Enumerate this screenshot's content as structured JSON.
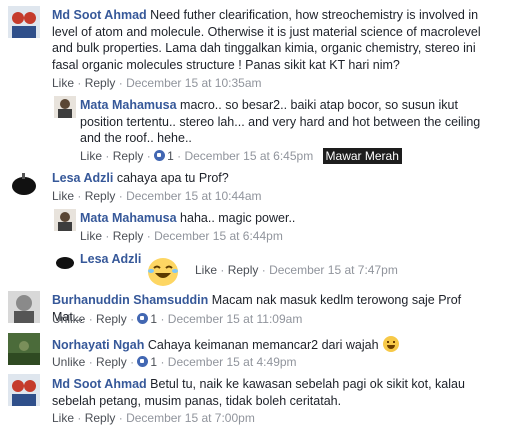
{
  "comments": [
    {
      "author": "Md Soot Ahmad",
      "text": "Need futher clearification, how streochemistry is involved in level of atom and molecule. Otherwise it is just material science of macrolevel and bulk properties. Lama dah tinggalkan kimia, organic chemistry, stereo ini fasal organic molecules structure ! Panas sikit kat KT hari nim?",
      "like": "Like",
      "reply": "Reply",
      "time": "December 15 at 10:35am"
    },
    {
      "author": "Mata Mahamusa",
      "text": "macro.. so besar2.. baiki atap bocor, so susun ikut position tertentu.. stereo lah... and very hard and hot between the ceiling and the roof.. hehe..",
      "like": "Like",
      "reply": "Reply",
      "count": "1",
      "time": "December 15 at 6:45pm",
      "tag": "Mawar Merah"
    },
    {
      "author": "Lesa Adzli",
      "text": "cahaya apa tu Prof?",
      "like": "Like",
      "reply": "Reply",
      "time": "December 15 at 10:44am"
    },
    {
      "author": "Mata Mahamusa",
      "text": "haha.. magic power..",
      "like": "Like",
      "reply": "Reply",
      "time": "December 15 at 6:44pm"
    },
    {
      "author": "Lesa Adzli",
      "like": "Like",
      "reply": "Reply",
      "time": "December 15 at 7:47pm",
      "sticker": "laughing-sticker"
    },
    {
      "author": "Burhanuddin Shamsuddin",
      "text": "Macam nak masuk kedlm terowong saje Prof Mat...",
      "like": "Unlike",
      "reply": "Reply",
      "count": "1",
      "time": "December 15 at 11:09am"
    },
    {
      "author": "Norhayati Ngah",
      "text": "Cahaya keimanan memancar2 dari wajah",
      "like": "Unlike",
      "reply": "Reply",
      "count": "1",
      "time": "December 15 at 4:49pm",
      "emoji": "grinning-emoji"
    },
    {
      "author": "Md Soot Ahmad",
      "text": "Betul tu, naik ke kawasan sebelah pagi ok sikit kot, kalau sebelah petang, musim panas, tidak boleh ceritatah.",
      "like": "Like",
      "reply": "Reply",
      "time": "December 15 at 7:00pm"
    }
  ],
  "sep": "·"
}
